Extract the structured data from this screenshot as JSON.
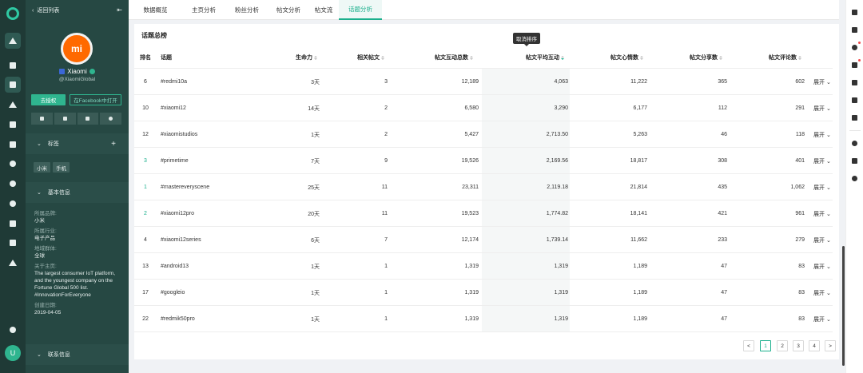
{
  "nav": {
    "back_label": "返回列表",
    "collapse_icon": "collapse-icon"
  },
  "profile": {
    "logo_text": "mi",
    "name": "Xiaomi",
    "handle": "@XiaomiGlobal",
    "auth_button": "去授权",
    "facebook_button": "在Facebook中打开"
  },
  "tags_section": {
    "title": "标签",
    "add_icon": "+",
    "tags": [
      "小米",
      "手机"
    ]
  },
  "basic_section": {
    "title": "基本信息",
    "fields": [
      {
        "label": "所属品牌:",
        "value": "小米"
      },
      {
        "label": "所属行业:",
        "value": "电子产品"
      },
      {
        "label": "地域群体:",
        "value": "全球"
      },
      {
        "label": "关于主页:",
        "value": "The largest consumer IoT platform, and the youngest company on the Fortune Global 500 list. #InnovationForEveryone"
      },
      {
        "label": "创建日期:",
        "value": "2019-04-05"
      }
    ]
  },
  "contact_section": {
    "title": "联系信息"
  },
  "avatar_letter": "U",
  "tabs": [
    {
      "label": "数据概览",
      "active": false
    },
    {
      "label": "主页分析",
      "active": false
    },
    {
      "label": "粉丝分析",
      "active": false
    },
    {
      "label": "帖文分析",
      "active": false
    },
    {
      "label": "帖文流",
      "active": false
    },
    {
      "label": "话题分析",
      "active": true
    }
  ],
  "table": {
    "title": "话题总榜",
    "tooltip": "取消排序",
    "headers": {
      "rank": "排名",
      "topic": "话题",
      "life": "生命力",
      "related": "相关帖文",
      "total": "帖文互动总数",
      "avg": "帖文平均互动",
      "reactions": "帖文心情数",
      "shares": "帖文分享数",
      "comments": "帖文评论数"
    },
    "expand_label": "展开",
    "rows": [
      {
        "rank": "6",
        "topic": "#redmi10a",
        "life": "3天",
        "related": "3",
        "total": "12,189",
        "avg": "4,063",
        "reactions": "11,222",
        "shares": "365",
        "comments": "602",
        "top": false
      },
      {
        "rank": "10",
        "topic": "#xiaomi12",
        "life": "14天",
        "related": "2",
        "total": "6,580",
        "avg": "3,290",
        "reactions": "6,177",
        "shares": "112",
        "comments": "291",
        "top": false
      },
      {
        "rank": "12",
        "topic": "#xiaomistudios",
        "life": "1天",
        "related": "2",
        "total": "5,427",
        "avg": "2,713.50",
        "reactions": "5,263",
        "shares": "46",
        "comments": "118",
        "top": false
      },
      {
        "rank": "3",
        "topic": "#primetime",
        "life": "7天",
        "related": "9",
        "total": "19,526",
        "avg": "2,169.56",
        "reactions": "18,817",
        "shares": "308",
        "comments": "401",
        "top": true
      },
      {
        "rank": "1",
        "topic": "#mastereveryscene",
        "life": "25天",
        "related": "11",
        "total": "23,311",
        "avg": "2,119.18",
        "reactions": "21,814",
        "shares": "435",
        "comments": "1,062",
        "top": true
      },
      {
        "rank": "2",
        "topic": "#xiaomi12pro",
        "life": "20天",
        "related": "11",
        "total": "19,523",
        "avg": "1,774.82",
        "reactions": "18,141",
        "shares": "421",
        "comments": "961",
        "top": true
      },
      {
        "rank": "4",
        "topic": "#xiaomi12series",
        "life": "6天",
        "related": "7",
        "total": "12,174",
        "avg": "1,739.14",
        "reactions": "11,662",
        "shares": "233",
        "comments": "279",
        "top": false
      },
      {
        "rank": "13",
        "topic": "#android13",
        "life": "1天",
        "related": "1",
        "total": "1,319",
        "avg": "1,319",
        "reactions": "1,189",
        "shares": "47",
        "comments": "83",
        "top": false
      },
      {
        "rank": "17",
        "topic": "#googleio",
        "life": "1天",
        "related": "1",
        "total": "1,319",
        "avg": "1,319",
        "reactions": "1,189",
        "shares": "47",
        "comments": "83",
        "top": false
      },
      {
        "rank": "22",
        "topic": "#redmik50pro",
        "life": "1天",
        "related": "1",
        "total": "1,319",
        "avg": "1,319",
        "reactions": "1,189",
        "shares": "47",
        "comments": "83",
        "top": false
      }
    ]
  },
  "pagination": {
    "prev": "<",
    "pages": [
      "1",
      "2",
      "3",
      "4"
    ],
    "current": "1",
    "next": ">"
  },
  "colors": {
    "accent": "#1aaf8c",
    "sidebar": "#264843",
    "rail": "#1f3a36",
    "brand": "#ff6900"
  }
}
